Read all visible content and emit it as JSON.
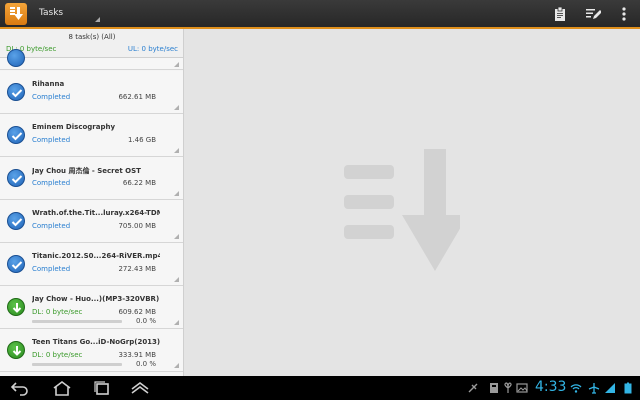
{
  "actionbar": {
    "title": "Tasks",
    "icons": [
      "download-app-icon",
      "clipboard-icon",
      "edit-list-icon",
      "overflow-menu-icon"
    ]
  },
  "summary": {
    "count": "8 task(s) (All)",
    "dl": "DL: 0 byte/sec",
    "ul": "UL: 0 byte/sec"
  },
  "tasks": [
    {
      "name": "Rihanna",
      "status": "Completed",
      "size": "662.61 MB",
      "state": "completed"
    },
    {
      "name": "Eminem Discography",
      "status": "Completed",
      "size": "1.46 GB",
      "state": "completed"
    },
    {
      "name": "Jay Chou 周杰倫 - Secret OST",
      "status": "Completed",
      "size": "66.22 MB",
      "state": "completed"
    },
    {
      "name": "Wrath.of.the.Tit...luray.x264-TDM",
      "status": "Completed",
      "size": "705.00 MB",
      "state": "completed"
    },
    {
      "name": "Titanic.2012.S0...264-RiVER.mp4",
      "status": "Completed",
      "size": "272.43 MB",
      "state": "completed"
    },
    {
      "name": "Jay Chow - Huo...)(MP3-320VBR)",
      "status": "DL: 0 byte/sec",
      "size": "609.62 MB",
      "progress": "0.0 %",
      "state": "downloading"
    },
    {
      "name": "Teen Titans Go...iD-NoGrp(2013)",
      "status": "DL: 0 byte/sec",
      "size": "333.91 MB",
      "progress": "0.0 %",
      "state": "downloading"
    }
  ],
  "statusbar": {
    "time": "4:33"
  },
  "colors": {
    "accent": "#e0901c",
    "completed": "#2a7fd0",
    "downloading": "#3a9a2a",
    "clock": "#33b5e5"
  }
}
